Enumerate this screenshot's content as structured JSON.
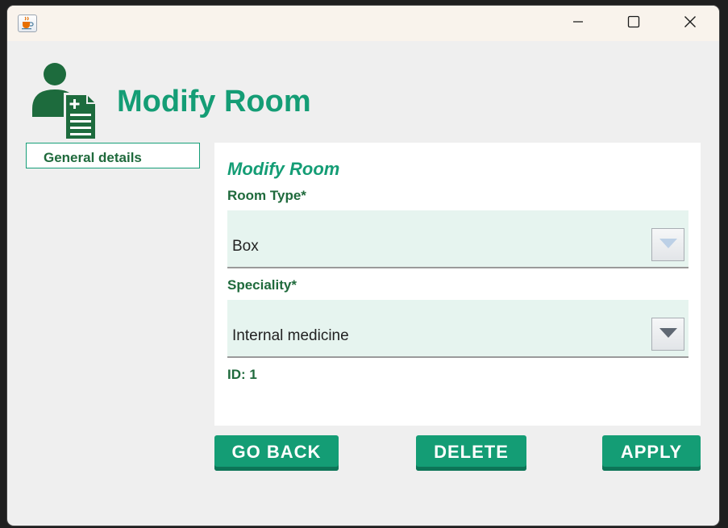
{
  "window": {
    "icons": {
      "app": "java-coffee-icon",
      "minimize": "minimize-icon",
      "maximize": "maximize-icon",
      "close": "close-icon"
    }
  },
  "header": {
    "icon": "patient-record-icon",
    "title": "Modify Room"
  },
  "sidebar": {
    "tabs": [
      {
        "label": "General details"
      }
    ]
  },
  "form": {
    "title": "Modify Room",
    "room_type": {
      "label": "Room Type*",
      "value": "Box"
    },
    "speciality": {
      "label": "Speciality*",
      "value": "Internal medicine"
    },
    "id_text": "ID: 1"
  },
  "actions": {
    "back_label": "GO BACK",
    "delete_label": "DELETE",
    "apply_label": "APPLY"
  },
  "colors": {
    "accent": "#149d75",
    "label_text": "#1f6a3c",
    "field_background": "#e6f4ef",
    "window_background": "#efefef"
  }
}
